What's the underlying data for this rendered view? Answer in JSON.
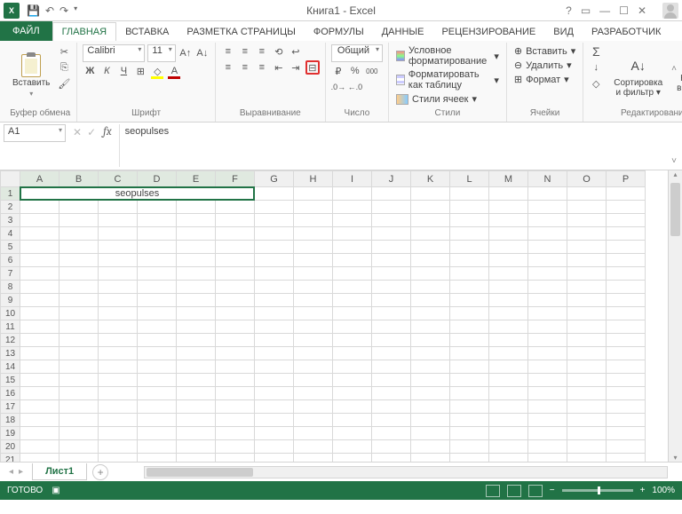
{
  "app": {
    "title": "Книга1 - Excel"
  },
  "tabs": {
    "file": "ФАЙЛ",
    "items": [
      "ГЛАВНАЯ",
      "ВСТАВКА",
      "РАЗМЕТКА СТРАНИЦЫ",
      "ФОРМУЛЫ",
      "ДАННЫЕ",
      "РЕЦЕНЗИРОВАНИЕ",
      "ВИД",
      "РАЗРАБОТЧИК"
    ],
    "active": 0
  },
  "ribbon": {
    "clipboard": {
      "paste": "Вставить",
      "label": "Буфер обмена"
    },
    "font": {
      "name": "Calibri",
      "size": "11",
      "label": "Шрифт"
    },
    "alignment": {
      "label": "Выравнивание"
    },
    "number": {
      "format": "Общий",
      "label": "Число",
      "currency": "₽",
      "percent": "%",
      "comma": "000"
    },
    "styles": {
      "cond": "Условное форматирование",
      "table": "Форматировать как таблицу",
      "cell": "Стили ячеек",
      "label": "Стили"
    },
    "cells": {
      "insert": "Вставить",
      "delete": "Удалить",
      "format": "Формат",
      "label": "Ячейки"
    },
    "editing": {
      "sort": "Сортировка",
      "filter": "и фильтр",
      "find": "Найти и",
      "select": "выделить",
      "label": "Редактирование"
    }
  },
  "namebox": {
    "ref": "A1"
  },
  "formula": {
    "value": "seopulses"
  },
  "grid": {
    "columns": [
      "A",
      "B",
      "C",
      "D",
      "E",
      "F",
      "G",
      "H",
      "I",
      "J",
      "K",
      "L",
      "M",
      "N",
      "O",
      "P"
    ],
    "rows": 22,
    "merged_cell": {
      "row": 1,
      "col_start": 0,
      "col_end": 5,
      "value": "seopulses"
    }
  },
  "sheets": {
    "active": "Лист1"
  },
  "status": {
    "ready": "ГОТОВО",
    "zoom": "100%"
  }
}
